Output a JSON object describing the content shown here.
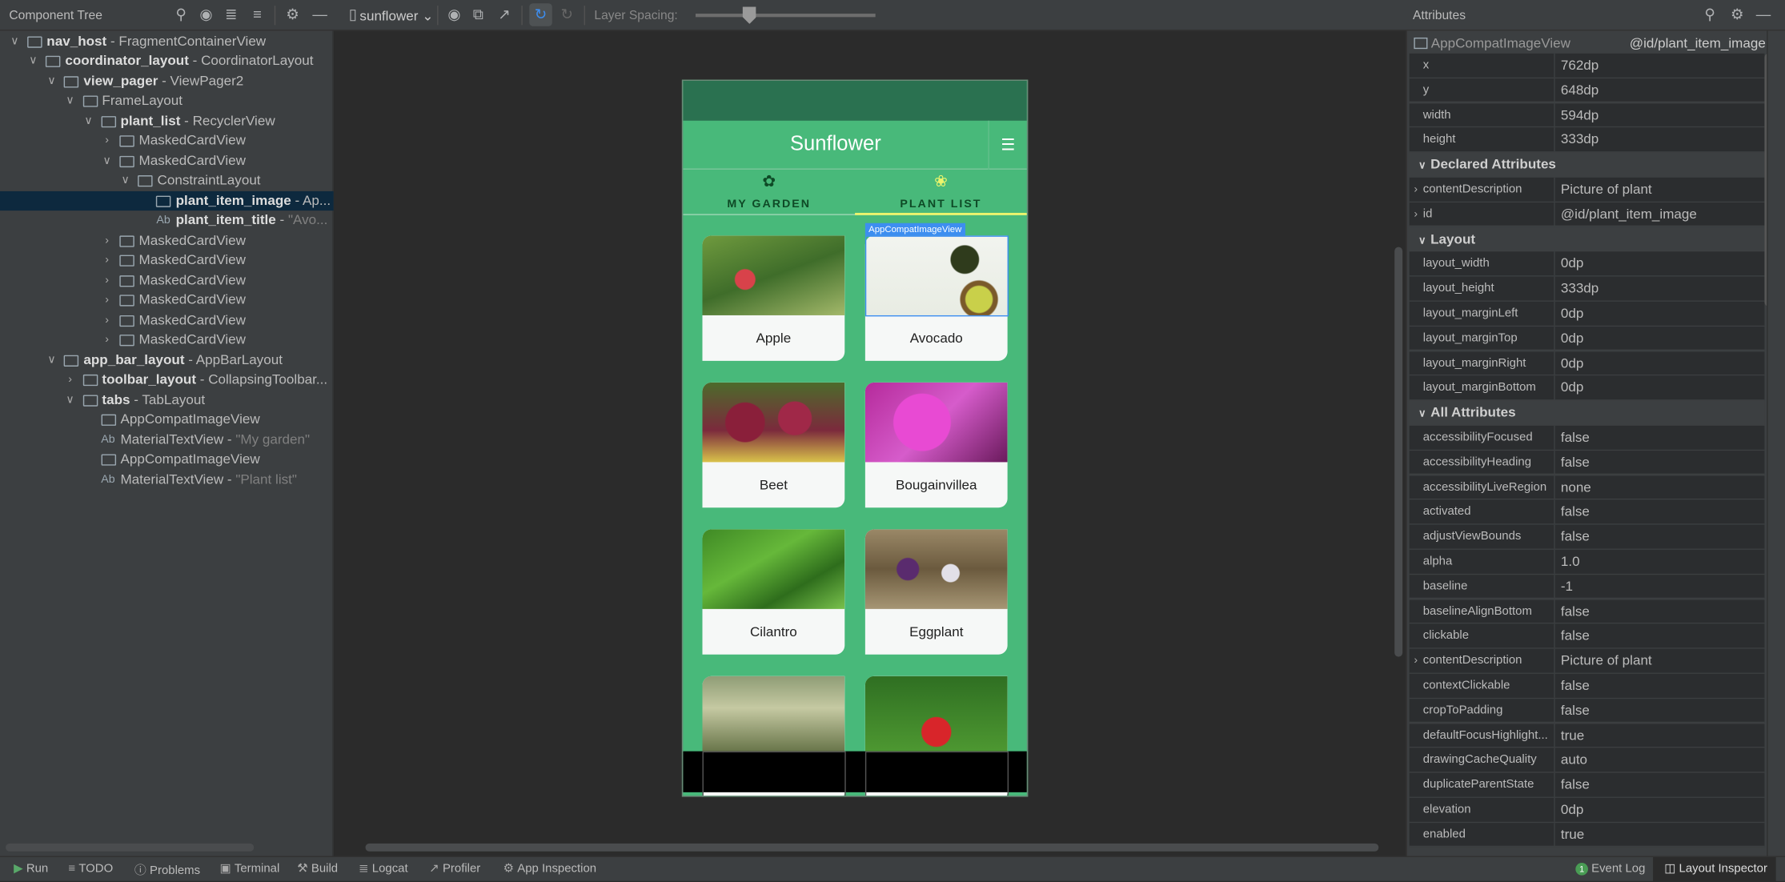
{
  "toolbar": {
    "panel_title": "Component Tree",
    "device": "sunflower",
    "layer_spacing_label": "Layer Spacing:",
    "layer_spacing_value": 0.3
  },
  "tree": [
    {
      "depth": 0,
      "exp": "v",
      "icon": "frame",
      "name": "nav_host",
      "type": "FragmentContainerView"
    },
    {
      "depth": 1,
      "exp": "v",
      "icon": "coord",
      "name": "coordinator_layout",
      "type": "CoordinatorLayout"
    },
    {
      "depth": 2,
      "exp": "v",
      "icon": "pager",
      "name": "view_pager",
      "type": "ViewPager2"
    },
    {
      "depth": 3,
      "exp": "v",
      "icon": "frame",
      "name": "",
      "type": "FrameLayout"
    },
    {
      "depth": 4,
      "exp": "v",
      "icon": "list",
      "name": "plant_list",
      "type": "RecyclerView"
    },
    {
      "depth": 5,
      "exp": ">",
      "icon": "card",
      "name": "",
      "type": "MaskedCardView"
    },
    {
      "depth": 5,
      "exp": "v",
      "icon": "card",
      "name": "",
      "type": "MaskedCardView"
    },
    {
      "depth": 6,
      "exp": "v",
      "icon": "constraint",
      "name": "",
      "type": "ConstraintLayout"
    },
    {
      "depth": 7,
      "exp": "",
      "icon": "image",
      "name": "plant_item_image",
      "type": "Ap...",
      "selected": true
    },
    {
      "depth": 7,
      "exp": "",
      "icon": "text",
      "name": "plant_item_title",
      "text": "\"Avo..."
    },
    {
      "depth": 5,
      "exp": ">",
      "icon": "card",
      "name": "",
      "type": "MaskedCardView"
    },
    {
      "depth": 5,
      "exp": ">",
      "icon": "card",
      "name": "",
      "type": "MaskedCardView"
    },
    {
      "depth": 5,
      "exp": ">",
      "icon": "card",
      "name": "",
      "type": "MaskedCardView"
    },
    {
      "depth": 5,
      "exp": ">",
      "icon": "card",
      "name": "",
      "type": "MaskedCardView"
    },
    {
      "depth": 5,
      "exp": ">",
      "icon": "card",
      "name": "",
      "type": "MaskedCardView"
    },
    {
      "depth": 5,
      "exp": ">",
      "icon": "card",
      "name": "",
      "type": "MaskedCardView"
    },
    {
      "depth": 2,
      "exp": "v",
      "icon": "appbar",
      "name": "app_bar_layout",
      "type": "AppBarLayout"
    },
    {
      "depth": 3,
      "exp": ">",
      "icon": "toolbar",
      "name": "toolbar_layout",
      "type": "CollapsingToolbar..."
    },
    {
      "depth": 3,
      "exp": "v",
      "icon": "folder",
      "name": "tabs",
      "type": "TabLayout"
    },
    {
      "depth": 4,
      "exp": "",
      "icon": "image",
      "name": "",
      "type": "AppCompatImageView"
    },
    {
      "depth": 4,
      "exp": "",
      "icon": "text",
      "name": "",
      "type": "MaterialTextView",
      "text": "\"My garden\""
    },
    {
      "depth": 4,
      "exp": "",
      "icon": "image",
      "name": "",
      "type": "AppCompatImageView"
    },
    {
      "depth": 4,
      "exp": "",
      "icon": "text",
      "name": "",
      "type": "MaterialTextView",
      "text": "\"Plant list\""
    }
  ],
  "app": {
    "title": "Sunflower",
    "tabs": [
      {
        "label": "MY GARDEN",
        "icon": "flower-icon"
      },
      {
        "label": "PLANT LIST",
        "icon": "sprout-icon"
      }
    ],
    "selection_tag": "AppCompatImageView",
    "plants": [
      "Apple",
      "Avocado",
      "Beet",
      "Bougainvillea",
      "Cilantro",
      "Eggplant",
      "",
      ""
    ],
    "colors": {
      "status": "#2a7150",
      "primary": "#48b97a",
      "indicator": "#ecf56b",
      "selection": "#3d8ef0"
    }
  },
  "attributes": {
    "title": "Attributes",
    "view_class": "AppCompatImageView",
    "view_id": "@id/plant_item_image",
    "dims": [
      [
        "x",
        "762dp"
      ],
      [
        "y",
        "648dp"
      ],
      [
        "width",
        "594dp"
      ],
      [
        "height",
        "333dp"
      ]
    ],
    "declared_title": "Declared Attributes",
    "declared": [
      [
        "contentDescription",
        "Picture of plant",
        true
      ],
      [
        "id",
        "@id/plant_item_image",
        true
      ]
    ],
    "layout_title": "Layout",
    "layout": [
      [
        "layout_width",
        "0dp"
      ],
      [
        "layout_height",
        "333dp"
      ],
      [
        "layout_marginLeft",
        "0dp"
      ],
      [
        "layout_marginTop",
        "0dp"
      ],
      [
        "layout_marginRight",
        "0dp"
      ],
      [
        "layout_marginBottom",
        "0dp"
      ]
    ],
    "all_title": "All Attributes",
    "all": [
      [
        "accessibilityFocused",
        "false"
      ],
      [
        "accessibilityHeading",
        "false"
      ],
      [
        "accessibilityLiveRegion",
        "none"
      ],
      [
        "activated",
        "false"
      ],
      [
        "adjustViewBounds",
        "false"
      ],
      [
        "alpha",
        "1.0"
      ],
      [
        "baseline",
        "-1"
      ],
      [
        "baselineAlignBottom",
        "false"
      ],
      [
        "clickable",
        "false"
      ],
      [
        "contentDescription",
        "Picture of plant",
        true
      ],
      [
        "contextClickable",
        "false"
      ],
      [
        "cropToPadding",
        "false"
      ],
      [
        "defaultFocusHighlight...",
        "true"
      ],
      [
        "drawingCacheQuality",
        "auto"
      ],
      [
        "duplicateParentState",
        "false"
      ],
      [
        "elevation",
        "0dp"
      ],
      [
        "enabled",
        "true"
      ]
    ]
  },
  "bottom": {
    "left": [
      "Run",
      "TODO",
      "Problems",
      "Terminal",
      "Build",
      "Logcat",
      "Profiler",
      "App Inspection"
    ],
    "event_log": "Event Log",
    "event_count": "1",
    "layout_inspector": "Layout Inspector"
  }
}
